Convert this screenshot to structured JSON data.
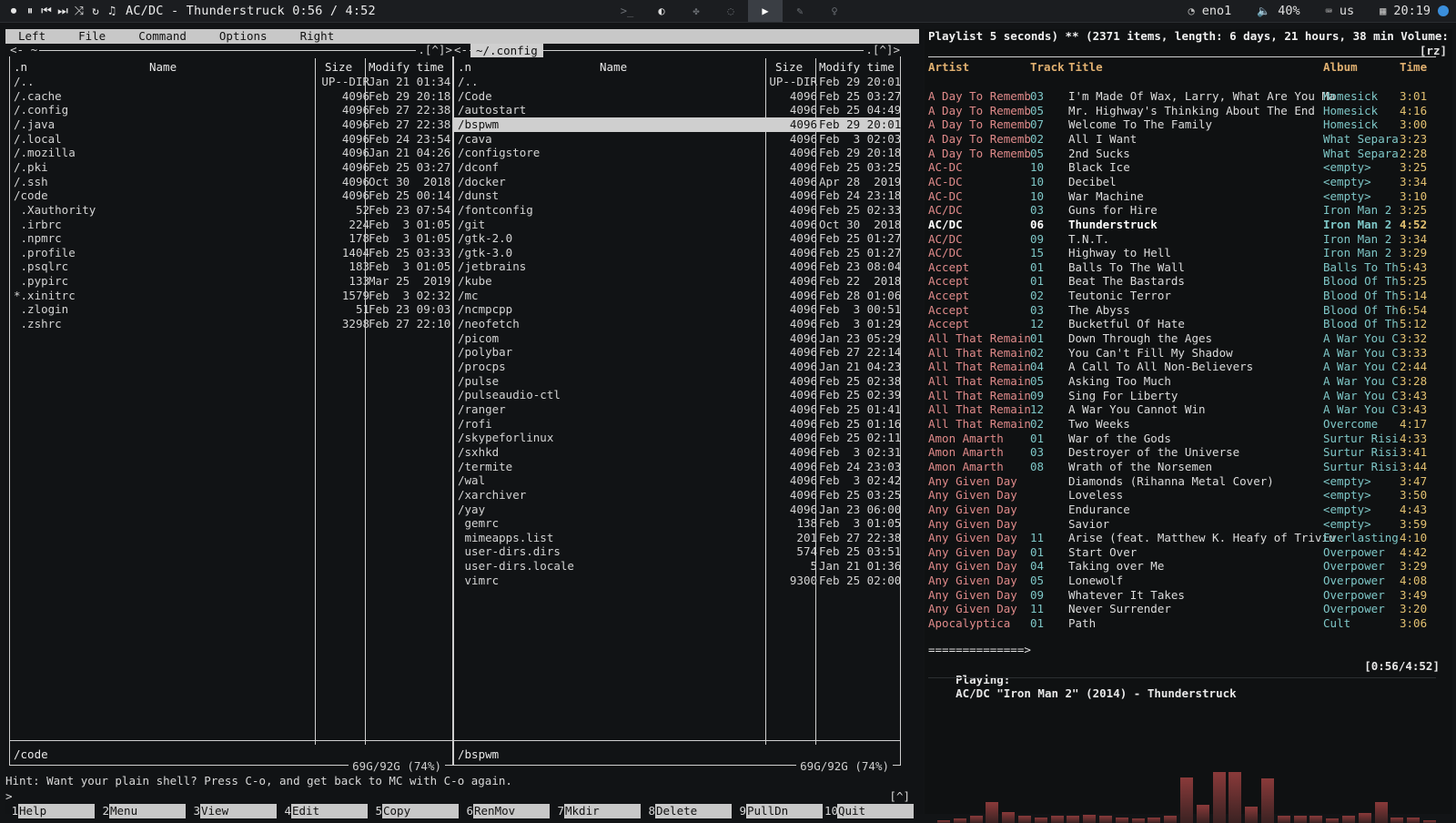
{
  "topbar": {
    "now_playing": "AC/DC - Thunderstruck 0:56 / 4:52",
    "controls": [
      "stop-icon",
      "pause-icon",
      "prev-icon",
      "next-icon",
      "shuffle-icon",
      "repeat-icon",
      "music-note-icon"
    ],
    "workspaces": [
      "terminal-icon",
      "moon-icon",
      "bug-icon",
      "chat-icon",
      "play-icon",
      "brush-icon",
      "bulb-icon"
    ],
    "active_workspace": 4,
    "network": "eno1",
    "volume": "40%",
    "keyboard": "us",
    "clock": "20:19",
    "accent": "#3b8fdc"
  },
  "mc": {
    "menu": [
      "Left",
      "File",
      "Command",
      "Options",
      "Right"
    ],
    "left_panel": {
      "corner_left": "<- ~",
      "corner_right": ".[^]>",
      "headers": {
        "name": ".n",
        "name_col": "Name",
        "size": "Size",
        "mtime": "Modify time"
      },
      "rows": [
        {
          "name": "/..",
          "size": "UP--DIR",
          "mtime": "Jan 21 01:34"
        },
        {
          "name": "/.cache",
          "size": "4096",
          "mtime": "Feb 29 20:18"
        },
        {
          "name": "/.config",
          "size": "4096",
          "mtime": "Feb 27 22:38"
        },
        {
          "name": "/.java",
          "size": "4096",
          "mtime": "Feb 27 22:38"
        },
        {
          "name": "/.local",
          "size": "4096",
          "mtime": "Feb 24 23:54"
        },
        {
          "name": "/.mozilla",
          "size": "4096",
          "mtime": "Jan 21 04:26"
        },
        {
          "name": "/.pki",
          "size": "4096",
          "mtime": "Feb 25 03:27"
        },
        {
          "name": "/.ssh",
          "size": "4096",
          "mtime": "Oct 30  2018"
        },
        {
          "name": "/code",
          "size": "4096",
          "mtime": "Feb 25 00:14"
        },
        {
          "name": " .Xauthority",
          "size": "52",
          "mtime": "Feb 23 07:54"
        },
        {
          "name": " .irbrc",
          "size": "224",
          "mtime": "Feb  3 01:05"
        },
        {
          "name": " .npmrc",
          "size": "178",
          "mtime": "Feb  3 01:05"
        },
        {
          "name": " .profile",
          "size": "1404",
          "mtime": "Feb 25 03:33"
        },
        {
          "name": " .psqlrc",
          "size": "183",
          "mtime": "Feb  3 01:05"
        },
        {
          "name": " .pypirc",
          "size": "133",
          "mtime": "Mar 25  2019"
        },
        {
          "name": "*.xinitrc",
          "size": "1579",
          "mtime": "Feb  3 02:32"
        },
        {
          "name": " .zlogin",
          "size": "51",
          "mtime": "Feb 23 09:03"
        },
        {
          "name": " .zshrc",
          "size": "3298",
          "mtime": "Feb 27 22:10"
        }
      ],
      "current": "/code",
      "disk": "69G/92G (74%)"
    },
    "right_panel": {
      "corner_left": "<-",
      "title": "~/.config",
      "corner_right": ".[^]>",
      "headers": {
        "name": ".n",
        "name_col": "Name",
        "size": "Size",
        "mtime": "Modify time"
      },
      "rows": [
        {
          "name": "/..",
          "size": "UP--DIR",
          "mtime": "Feb 29 20:01"
        },
        {
          "name": "/Code",
          "size": "4096",
          "mtime": "Feb 25 03:27"
        },
        {
          "name": "/autostart",
          "size": "4096",
          "mtime": "Feb 25 04:49"
        },
        {
          "name": "/bspwm",
          "size": "4096",
          "mtime": "Feb 29 20:01",
          "selected": true
        },
        {
          "name": "/cava",
          "size": "4096",
          "mtime": "Feb  3 02:03"
        },
        {
          "name": "/configstore",
          "size": "4096",
          "mtime": "Feb 29 20:18"
        },
        {
          "name": "/dconf",
          "size": "4096",
          "mtime": "Feb 25 03:25"
        },
        {
          "name": "/docker",
          "size": "4096",
          "mtime": "Apr 28  2019"
        },
        {
          "name": "/dunst",
          "size": "4096",
          "mtime": "Feb 24 23:18"
        },
        {
          "name": "/fontconfig",
          "size": "4096",
          "mtime": "Feb 25 02:33"
        },
        {
          "name": "/git",
          "size": "4096",
          "mtime": "Oct 30  2018"
        },
        {
          "name": "/gtk-2.0",
          "size": "4096",
          "mtime": "Feb 25 01:27"
        },
        {
          "name": "/gtk-3.0",
          "size": "4096",
          "mtime": "Feb 25 01:27"
        },
        {
          "name": "/jetbrains",
          "size": "4096",
          "mtime": "Feb 23 08:04"
        },
        {
          "name": "/kube",
          "size": "4096",
          "mtime": "Feb 22  2018"
        },
        {
          "name": "/mc",
          "size": "4096",
          "mtime": "Feb 28 01:06"
        },
        {
          "name": "/ncmpcpp",
          "size": "4096",
          "mtime": "Feb  3 00:51"
        },
        {
          "name": "/neofetch",
          "size": "4096",
          "mtime": "Feb  3 01:29"
        },
        {
          "name": "/picom",
          "size": "4096",
          "mtime": "Jan 23 05:29"
        },
        {
          "name": "/polybar",
          "size": "4096",
          "mtime": "Feb 27 22:14"
        },
        {
          "name": "/procps",
          "size": "4096",
          "mtime": "Jan 21 04:23"
        },
        {
          "name": "/pulse",
          "size": "4096",
          "mtime": "Feb 25 02:38"
        },
        {
          "name": "/pulseaudio-ctl",
          "size": "4096",
          "mtime": "Feb 25 02:39"
        },
        {
          "name": "/ranger",
          "size": "4096",
          "mtime": "Feb 25 01:41"
        },
        {
          "name": "/rofi",
          "size": "4096",
          "mtime": "Feb 25 01:16"
        },
        {
          "name": "/skypeforlinux",
          "size": "4096",
          "mtime": "Feb 25 02:11"
        },
        {
          "name": "/sxhkd",
          "size": "4096",
          "mtime": "Feb  3 02:31"
        },
        {
          "name": "/termite",
          "size": "4096",
          "mtime": "Feb 24 23:03"
        },
        {
          "name": "/wal",
          "size": "4096",
          "mtime": "Feb  3 02:42"
        },
        {
          "name": "/xarchiver",
          "size": "4096",
          "mtime": "Feb 25 03:25"
        },
        {
          "name": "/yay",
          "size": "4096",
          "mtime": "Jan 23 06:00"
        },
        {
          "name": " gemrc",
          "size": "138",
          "mtime": "Feb  3 01:05"
        },
        {
          "name": " mimeapps.list",
          "size": "201",
          "mtime": "Feb 27 22:38"
        },
        {
          "name": " user-dirs.dirs",
          "size": "574",
          "mtime": "Feb 25 03:51"
        },
        {
          "name": " user-dirs.locale",
          "size": "5",
          "mtime": "Jan 21 01:36"
        },
        {
          "name": " vimrc",
          "size": "9300",
          "mtime": "Feb 25 02:00"
        }
      ],
      "current": "/bspwm",
      "disk": "69G/92G (74%)"
    },
    "hint": "Hint: Want your plain shell? Press C-o, and get back to MC with C-o again.",
    "prompt": ">",
    "prompt_right": "[^]",
    "fkeys": [
      {
        "n": "1",
        "label": "Help"
      },
      {
        "n": "2",
        "label": "Menu"
      },
      {
        "n": "3",
        "label": "View"
      },
      {
        "n": "4",
        "label": "Edit"
      },
      {
        "n": "5",
        "label": "Copy"
      },
      {
        "n": "6",
        "label": "RenMov"
      },
      {
        "n": "7",
        "label": "Mkdir"
      },
      {
        "n": "8",
        "label": "Delete"
      },
      {
        "n": "9",
        "label": "PullDn"
      },
      {
        "n": "10",
        "label": "Quit"
      }
    ]
  },
  "ncmpcpp": {
    "header": "Playlist 5 seconds) ** (2371 items, length: 6 days, 21 hours, 38 min Volume: 100%",
    "flags": "[rz]",
    "columns": {
      "artist": "Artist",
      "track": "Track",
      "title": "Title",
      "album": "Album",
      "time": "Time"
    },
    "tracks": [
      {
        "artist": "A Day To Rememb",
        "track": "03",
        "title": "I'm Made Of Wax, Larry, What Are You Ma",
        "album": "Homesick",
        "time": "3:01"
      },
      {
        "artist": "A Day To Rememb",
        "track": "05",
        "title": "Mr. Highway's Thinking About The End",
        "album": "Homesick",
        "time": "4:16"
      },
      {
        "artist": "A Day To Rememb",
        "track": "07",
        "title": "Welcome To The Family",
        "album": "Homesick",
        "time": "3:00"
      },
      {
        "artist": "A Day To Rememb",
        "track": "02",
        "title": "All I Want",
        "album": "What Separa",
        "time": "3:23"
      },
      {
        "artist": "A Day To Rememb",
        "track": "05",
        "title": "2nd Sucks",
        "album": "What Separa",
        "time": "2:28"
      },
      {
        "artist": "AC-DC",
        "track": "10",
        "title": "Black Ice",
        "album": "<empty>",
        "time": "3:25"
      },
      {
        "artist": "AC-DC",
        "track": "10",
        "title": "Decibel",
        "album": "<empty>",
        "time": "3:34"
      },
      {
        "artist": "AC-DC",
        "track": "10",
        "title": "War Machine",
        "album": "<empty>",
        "time": "3:10"
      },
      {
        "artist": "AC/DC",
        "track": "03",
        "title": "Guns for Hire",
        "album": "Iron Man 2",
        "time": "3:25"
      },
      {
        "artist": "AC/DC",
        "track": "06",
        "title": "Thunderstruck",
        "album": "Iron Man 2",
        "time": "4:52",
        "current": true
      },
      {
        "artist": "AC/DC",
        "track": "09",
        "title": "T.N.T.",
        "album": "Iron Man 2",
        "time": "3:34"
      },
      {
        "artist": "AC/DC",
        "track": "15",
        "title": "Highway to Hell",
        "album": "Iron Man 2",
        "time": "3:29"
      },
      {
        "artist": "Accept",
        "track": "01",
        "title": "Balls To The Wall",
        "album": "Balls To Th",
        "time": "5:43"
      },
      {
        "artist": "Accept",
        "track": "01",
        "title": "Beat The Bastards",
        "album": "Blood Of Th",
        "time": "5:25"
      },
      {
        "artist": "Accept",
        "track": "02",
        "title": "Teutonic Terror",
        "album": "Blood Of Th",
        "time": "5:14"
      },
      {
        "artist": "Accept",
        "track": "03",
        "title": "The Abyss",
        "album": "Blood Of Th",
        "time": "6:54"
      },
      {
        "artist": "Accept",
        "track": "12",
        "title": "Bucketful Of Hate",
        "album": "Blood Of Th",
        "time": "5:12"
      },
      {
        "artist": "All That Remain",
        "track": "01",
        "title": "Down Through the Ages",
        "album": "A War You C",
        "time": "3:32"
      },
      {
        "artist": "All That Remain",
        "track": "02",
        "title": "You Can't Fill My Shadow",
        "album": "A War You C",
        "time": "3:33"
      },
      {
        "artist": "All That Remain",
        "track": "04",
        "title": "A Call To All Non-Believers",
        "album": "A War You C",
        "time": "2:44"
      },
      {
        "artist": "All That Remain",
        "track": "05",
        "title": "Asking Too Much",
        "album": "A War You C",
        "time": "3:28"
      },
      {
        "artist": "All That Remain",
        "track": "09",
        "title": "Sing For Liberty",
        "album": "A War You C",
        "time": "3:43"
      },
      {
        "artist": "All That Remain",
        "track": "12",
        "title": "A War You Cannot Win",
        "album": "A War You C",
        "time": "3:43"
      },
      {
        "artist": "All That Remain",
        "track": "02",
        "title": "Two Weeks",
        "album": "Overcome",
        "time": "4:17"
      },
      {
        "artist": "Amon Amarth",
        "track": "01",
        "title": "War of the Gods",
        "album": "Surtur Risi",
        "time": "4:33"
      },
      {
        "artist": "Amon Amarth",
        "track": "03",
        "title": "Destroyer of the Universe",
        "album": "Surtur Risi",
        "time": "3:41"
      },
      {
        "artist": "Amon Amarth",
        "track": "08",
        "title": "Wrath of the Norsemen",
        "album": "Surtur Risi",
        "time": "3:44"
      },
      {
        "artist": "Any Given Day",
        "track": "",
        "title": "Diamonds (Rihanna Metal Cover)",
        "album": "<empty>",
        "time": "3:47"
      },
      {
        "artist": "Any Given Day",
        "track": "",
        "title": "Loveless",
        "album": "<empty>",
        "time": "3:50"
      },
      {
        "artist": "Any Given Day",
        "track": "",
        "title": "Endurance",
        "album": "<empty>",
        "time": "4:43"
      },
      {
        "artist": "Any Given Day",
        "track": "",
        "title": "Savior",
        "album": "<empty>",
        "time": "3:59"
      },
      {
        "artist": "Any Given Day",
        "track": "11",
        "title": "Arise (feat. Matthew K. Heafy of Triviu",
        "album": "Everlasting",
        "time": "4:10"
      },
      {
        "artist": "Any Given Day",
        "track": "01",
        "title": "Start Over",
        "album": "Overpower",
        "time": "4:42"
      },
      {
        "artist": "Any Given Day",
        "track": "04",
        "title": "Taking over Me",
        "album": "Overpower",
        "time": "3:29"
      },
      {
        "artist": "Any Given Day",
        "track": "05",
        "title": "Lonewolf",
        "album": "Overpower",
        "time": "4:08"
      },
      {
        "artist": "Any Given Day",
        "track": "09",
        "title": "Whatever It Takes",
        "album": "Overpower",
        "time": "3:49"
      },
      {
        "artist": "Any Given Day",
        "track": "11",
        "title": "Never Surrender",
        "album": "Overpower",
        "time": "3:20"
      },
      {
        "artist": "Apocalyptica",
        "track": "01",
        "title": "Path",
        "album": "Cult",
        "time": "3:06"
      }
    ],
    "progress_text": "==============>",
    "status_label": "Playing:",
    "status_text": "AC/DC \"Iron Man 2\" (2014) - Thunderstruck",
    "position": "[0:56/4:52]",
    "visualizer_levels": [
      0.02,
      0.03,
      0.05,
      0.15,
      0.08,
      0.05,
      0.04,
      0.05,
      0.05,
      0.06,
      0.05,
      0.04,
      0.03,
      0.04,
      0.05,
      0.33,
      0.13,
      0.37,
      0.37,
      0.12,
      0.32,
      0.05,
      0.05,
      0.05,
      0.03,
      0.05,
      0.07,
      0.15,
      0.04,
      0.04,
      0.02
    ]
  }
}
